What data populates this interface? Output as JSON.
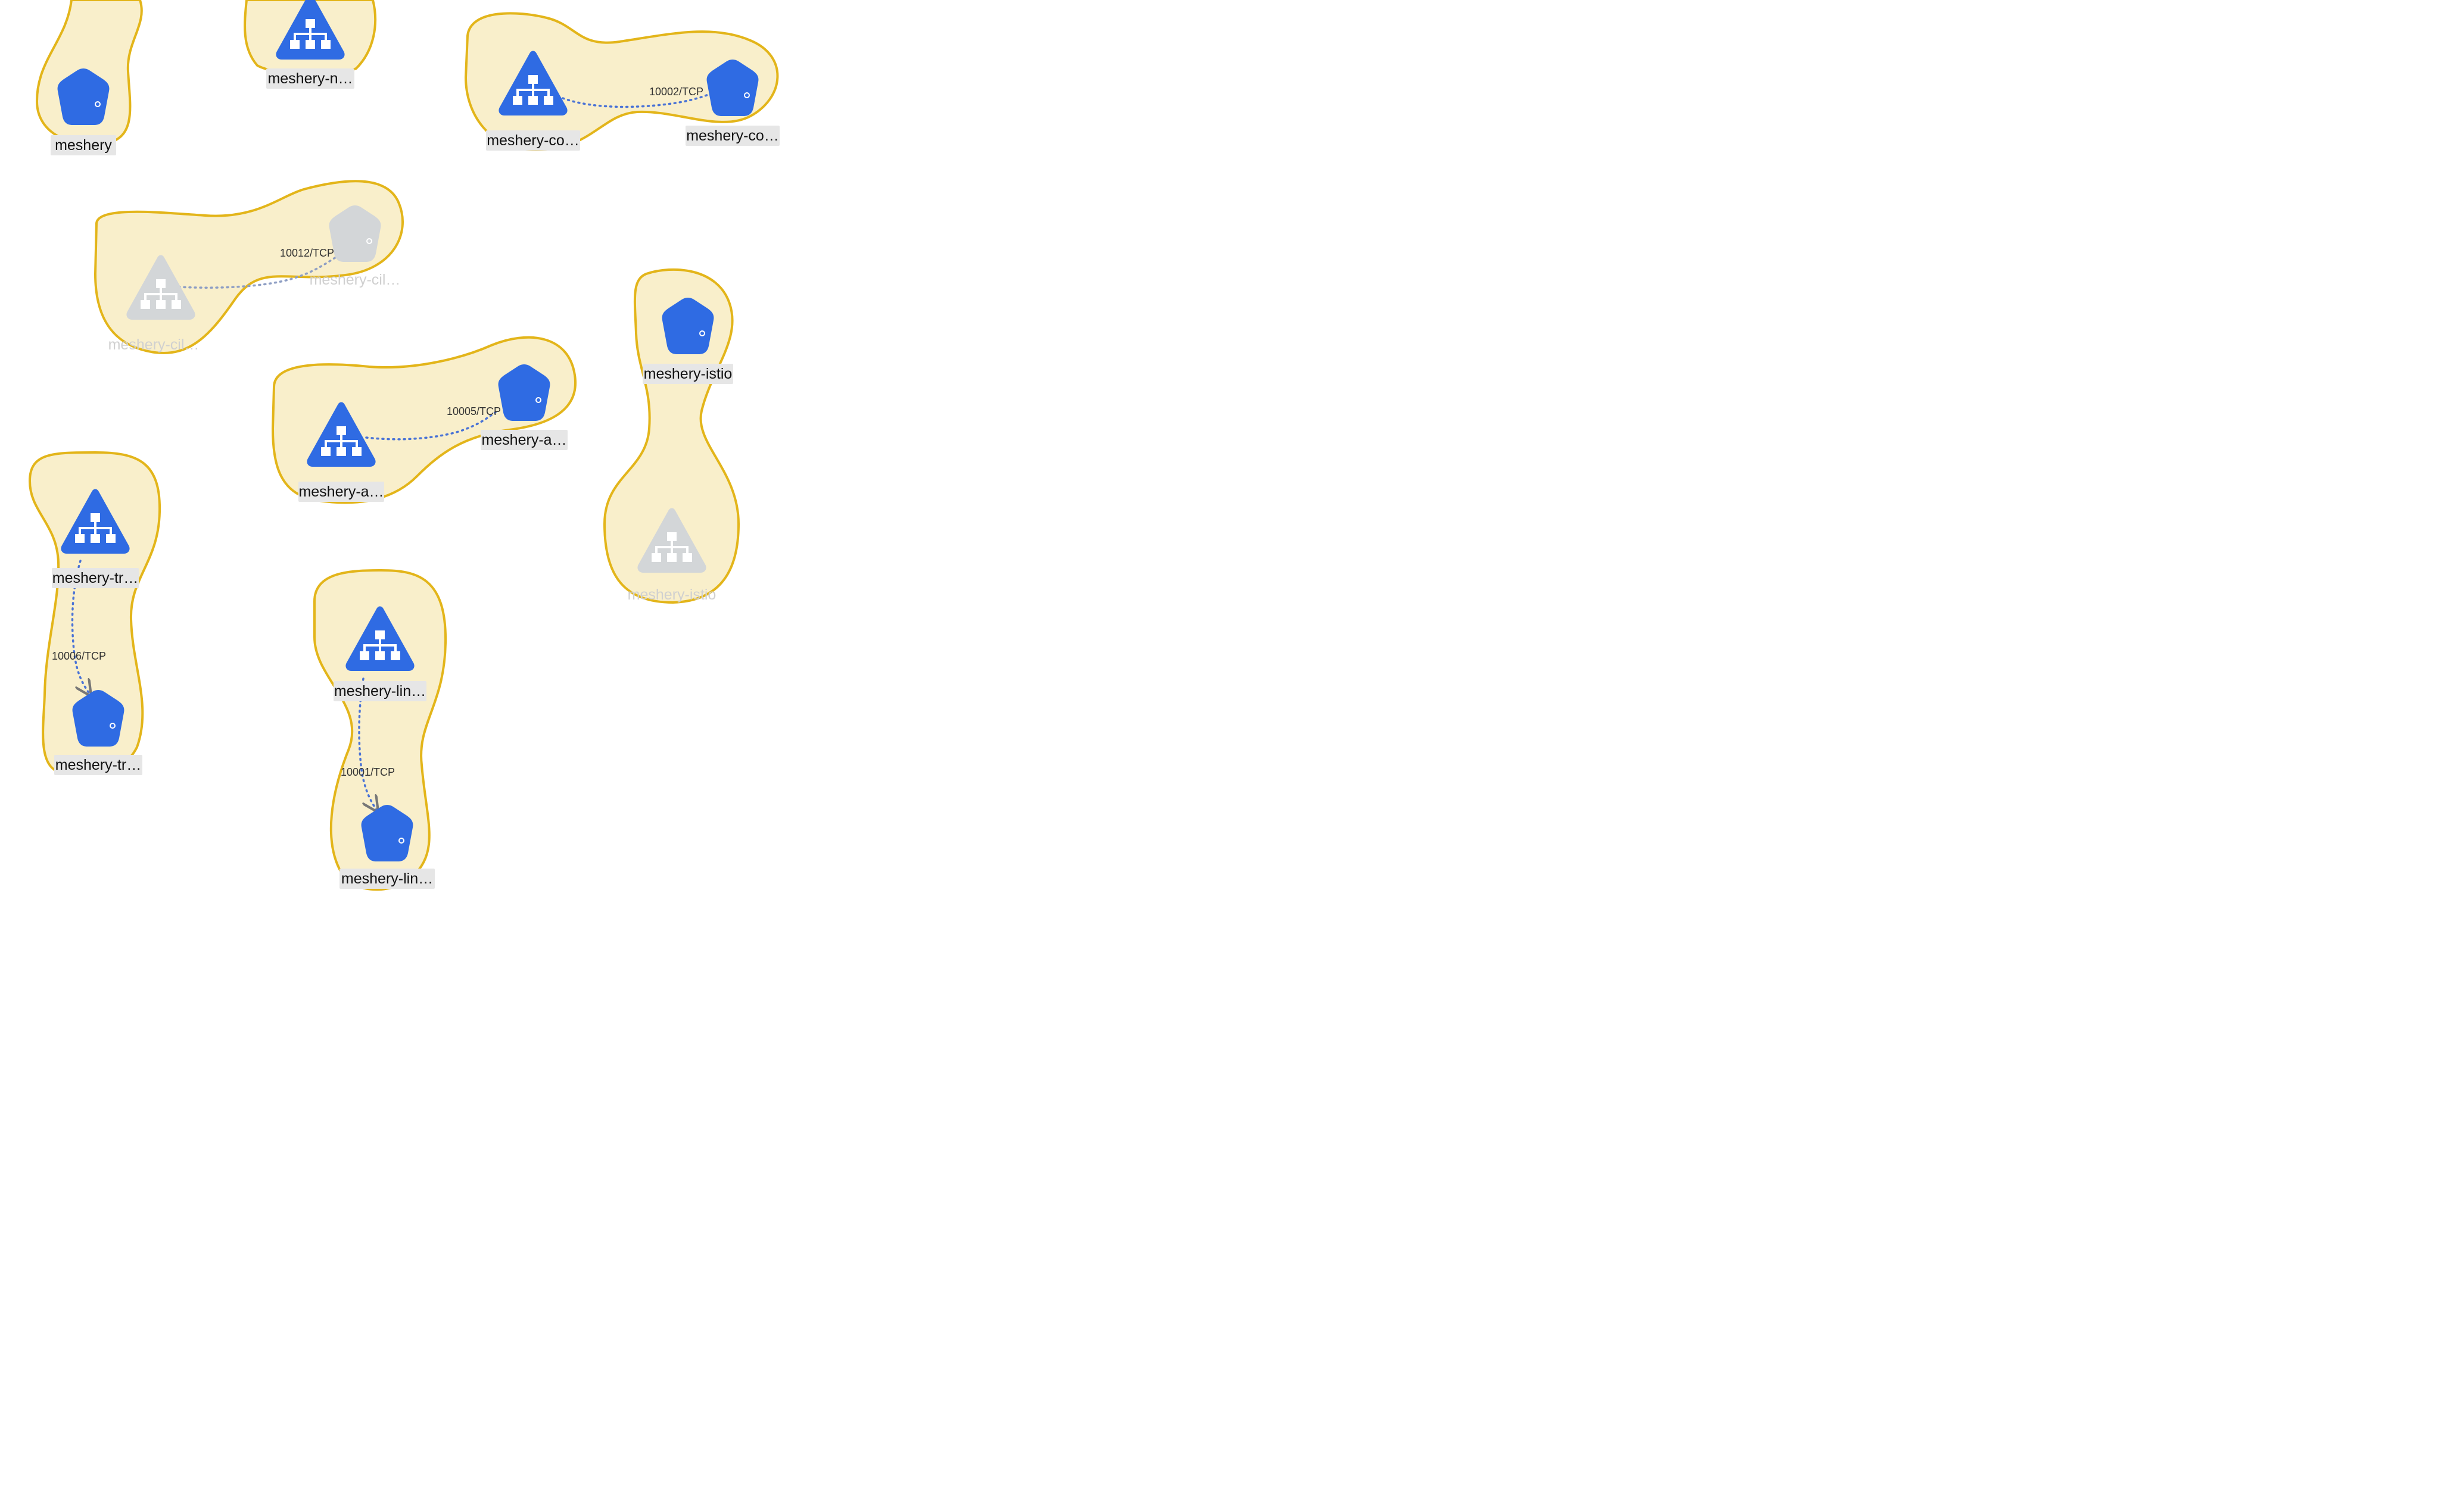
{
  "colors": {
    "node_active": "#2f6be3",
    "node_muted": "#d3d6d8",
    "group_fill": "#f9efcb",
    "group_stroke": "#e3b51a"
  },
  "nodes": {
    "n1": {
      "label": "meshery",
      "kind": "pod-icon"
    },
    "n2": {
      "label": "meshery-n…",
      "kind": "service-icon"
    },
    "n3": {
      "label": "meshery-co…",
      "kind": "service-icon"
    },
    "n4": {
      "label": "meshery-co…",
      "kind": "pod-icon"
    },
    "n5": {
      "label": "meshery-cil…",
      "kind": "pod-icon",
      "muted": true
    },
    "n6": {
      "label": "meshery-cil…",
      "kind": "service-icon",
      "muted": true
    },
    "n7": {
      "label": "meshery-istio",
      "kind": "pod-icon"
    },
    "n8": {
      "label": "meshery-istio",
      "kind": "service-icon",
      "muted": true
    },
    "n9": {
      "label": "meshery-a…",
      "kind": "pod-icon"
    },
    "n10": {
      "label": "meshery-a…",
      "kind": "service-icon"
    },
    "n11": {
      "label": "meshery-tr…",
      "kind": "service-icon"
    },
    "n12": {
      "label": "meshery-tr…",
      "kind": "pod-icon"
    },
    "n13": {
      "label": "meshery-lin…",
      "kind": "service-icon"
    },
    "n14": {
      "label": "meshery-lin…",
      "kind": "pod-icon"
    }
  },
  "edges": {
    "e1": {
      "label": "10002/TCP"
    },
    "e2": {
      "label": "10012/TCP"
    },
    "e3": {
      "label": "10005/TCP"
    },
    "e4": {
      "label": "10006/TCP"
    },
    "e5": {
      "label": "10001/TCP"
    }
  }
}
